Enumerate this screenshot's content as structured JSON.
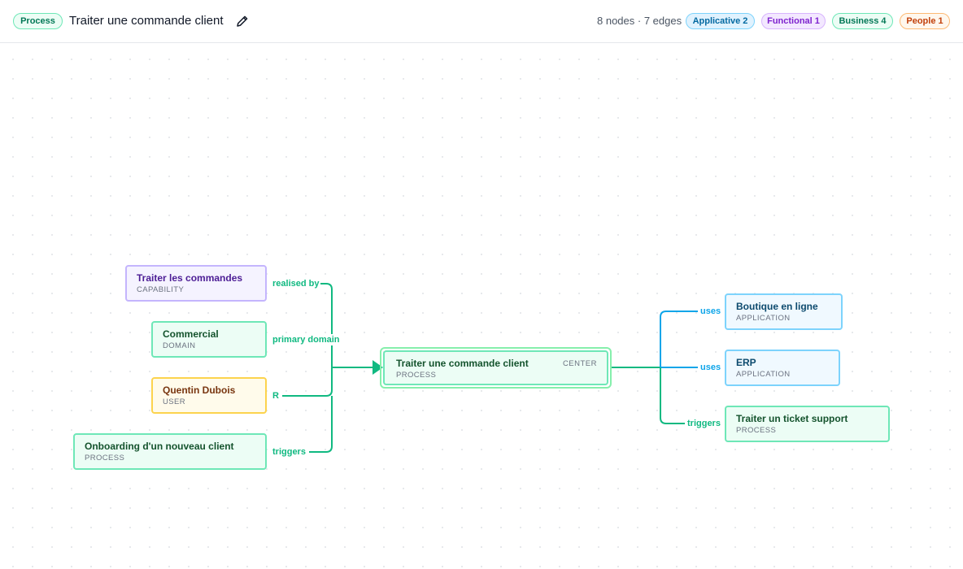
{
  "header": {
    "type_badge": "Process",
    "title": "Traiter une commande client",
    "stats": "8 nodes · 7 edges",
    "edit_icon": "pencil-icon",
    "filters": [
      {
        "label": "Applicative 2",
        "color": "#0284c7",
        "bg": "#e0f2fe",
        "border": "#7dd3fc"
      },
      {
        "label": "Functional 1",
        "color": "#7e22ce",
        "bg": "#f3e8ff",
        "border": "#d8b4fe"
      },
      {
        "label": "Business 4",
        "color": "#047857",
        "bg": "#ecfdf5",
        "border": "#6ee7b7"
      },
      {
        "label": "People 1",
        "color": "#c2410c",
        "bg": "#fff7ed",
        "border": "#fdba74"
      }
    ]
  },
  "colors": {
    "business_edge": "#10b981",
    "applicative_edge": "#0ea5e9"
  },
  "graph": {
    "center": {
      "title": "Traiter une commande client",
      "type": "PROCESS",
      "tag": "CENTER"
    },
    "left_nodes": [
      {
        "title": "Traiter les commandes",
        "type": "CAPABILITY",
        "edge": "realised by",
        "category": "functional"
      },
      {
        "title": "Commercial",
        "type": "DOMAIN",
        "edge": "primary domain",
        "category": "business"
      },
      {
        "title": "Quentin Dubois",
        "type": "USER",
        "edge": "R",
        "category": "people"
      },
      {
        "title": "Onboarding d'un nouveau client",
        "type": "PROCESS",
        "edge": "triggers",
        "category": "business"
      }
    ],
    "right_nodes": [
      {
        "title": "Boutique en ligne",
        "type": "APPLICATION",
        "edge": "uses",
        "category": "applicative"
      },
      {
        "title": "ERP",
        "type": "APPLICATION",
        "edge": "uses",
        "category": "applicative"
      },
      {
        "title": "Traiter un ticket support",
        "type": "PROCESS",
        "edge": "triggers",
        "category": "business"
      }
    ]
  }
}
